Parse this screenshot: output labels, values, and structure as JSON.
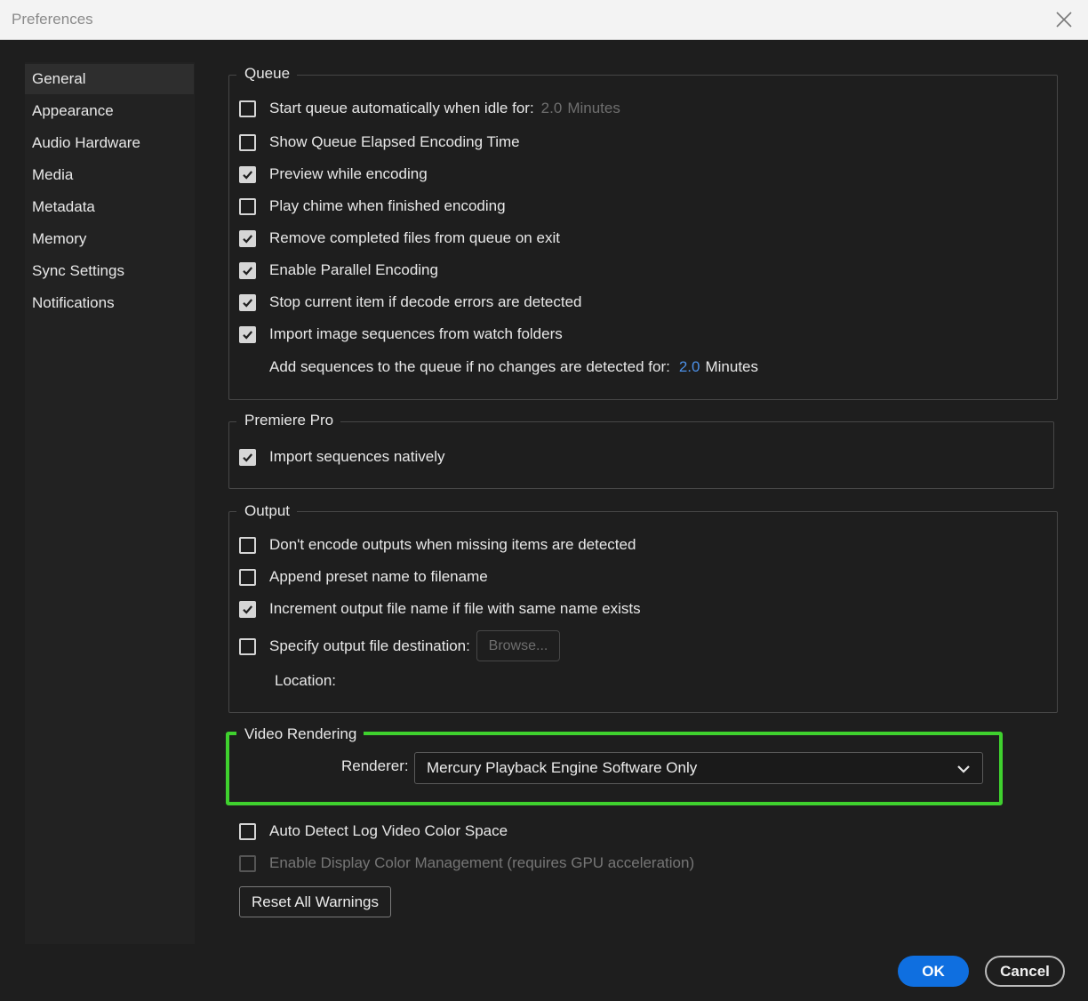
{
  "window": {
    "title": "Preferences"
  },
  "sidebar": {
    "items": [
      {
        "label": "General",
        "active": true
      },
      {
        "label": "Appearance"
      },
      {
        "label": "Audio Hardware"
      },
      {
        "label": "Media"
      },
      {
        "label": "Metadata"
      },
      {
        "label": "Memory"
      },
      {
        "label": "Sync Settings"
      },
      {
        "label": "Notifications"
      }
    ]
  },
  "queue": {
    "legend": "Queue",
    "start_auto": {
      "label": "Start queue automatically when idle for:",
      "checked": false,
      "value": "2.0",
      "unit": "Minutes"
    },
    "show_elapsed": {
      "label": "Show Queue Elapsed Encoding Time",
      "checked": false
    },
    "preview": {
      "label": "Preview while encoding",
      "checked": true
    },
    "chime": {
      "label": "Play chime when finished encoding",
      "checked": false
    },
    "remove_completed": {
      "label": "Remove completed files from queue on exit",
      "checked": true
    },
    "parallel": {
      "label": "Enable Parallel Encoding",
      "checked": true
    },
    "stop_decode": {
      "label": "Stop current item if decode errors are detected",
      "checked": true
    },
    "import_seq": {
      "label": "Import image sequences from watch folders",
      "checked": true
    },
    "add_seq": {
      "label": "Add sequences to the queue if no changes are detected for:",
      "value": "2.0",
      "unit": "Minutes"
    }
  },
  "premiere": {
    "legend": "Premiere Pro",
    "import_native": {
      "label": "Import sequences natively",
      "checked": true
    }
  },
  "output": {
    "legend": "Output",
    "dont_encode": {
      "label": "Don't encode outputs when missing items are detected",
      "checked": false
    },
    "append_preset": {
      "label": "Append preset name to filename",
      "checked": false
    },
    "increment": {
      "label": "Increment output file name if file with same name exists",
      "checked": true
    },
    "specify_dest": {
      "label": "Specify output file destination:",
      "checked": false
    },
    "browse_label": "Browse...",
    "location_label": "Location:"
  },
  "video_rendering": {
    "legend": "Video Rendering",
    "renderer_label": "Renderer:",
    "renderer_value": "Mercury Playback Engine Software Only"
  },
  "misc": {
    "auto_detect": {
      "label": "Auto Detect Log Video Color Space",
      "checked": false
    },
    "display_color": {
      "label": "Enable Display Color Management (requires GPU acceleration)",
      "checked": false,
      "disabled": true
    },
    "reset_label": "Reset All Warnings"
  },
  "footer": {
    "ok_label": "OK",
    "cancel_label": "Cancel"
  },
  "colors": {
    "accent": "#0f6fe0",
    "highlight": "#3fd12e",
    "link_value": "#4c90e6"
  },
  "icons": {
    "close": "close-icon",
    "check": "check-icon",
    "dropdown": "chevron-down-icon"
  }
}
